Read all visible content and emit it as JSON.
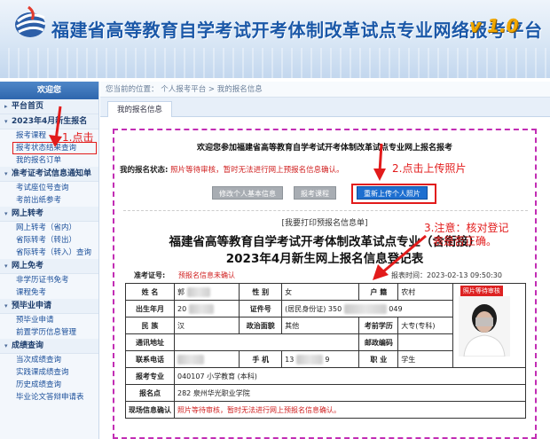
{
  "header": {
    "title": "福建省高等教育自学考试开考体制改革试点专业网络报考平台",
    "version": "v 1.0"
  },
  "sidebar": {
    "welcome": "欢迎您",
    "sections": [
      {
        "label": "平台首页",
        "items": []
      },
      {
        "label": "2023年4月新生报名",
        "items": [
          "报考课程",
          "报考状态结果查询",
          "我的报名订单"
        ]
      },
      {
        "label": "准考证考试信息通知单",
        "items": [
          "考试座位号查询",
          "考前出纸参考"
        ]
      },
      {
        "label": "网上转考",
        "items": [
          "网上转考（省内）",
          "省际转考（转出）",
          "省际转考（转入）查询"
        ]
      },
      {
        "label": "网上免考",
        "items": [
          "非学历证书免考",
          "课程免考"
        ]
      },
      {
        "label": "预毕业申请",
        "items": [
          "预毕业申请",
          "前置学历信息管理"
        ]
      },
      {
        "label": "成绩查询",
        "items": [
          "当次成绩查询",
          "实践课成绩查询",
          "历史成绩查询",
          "毕业论文答辩申请表"
        ]
      }
    ]
  },
  "breadcrumb": "您当前的位置：  个人报考平台 > 我的报名信息",
  "tab": "我的报名信息",
  "content": {
    "intro": "欢迎您参加福建省高等教育自学考试开考体制改革试点专业网上报名报考",
    "status_label": "我的报名状态:",
    "status_value": "照片等待审核，暂时无法进行网上预报名信息确认。",
    "buttons": {
      "modify": "修改个人基本信息",
      "course": "报考课程",
      "reupload": "重新上传个人照片"
    },
    "print": "[我要打印预报名信息单]",
    "title_line1": "福建省高等教育自学考试开考体制改革试点专业（含衔接）",
    "title_line2": "2023年4月新生网上报名信息登记表",
    "ticket_label": "准考证号:",
    "ticket_value": "预报名信息未确认",
    "report_time": "报表时间：2023-02-13 09:50:30"
  },
  "table": {
    "name_k": "姓 名",
    "name_v": "郭",
    "gender_k": "性 别",
    "gender_v": "女",
    "hukou_k": "户 籍",
    "hukou_v": "农村",
    "photo_tag": "照片等待审核",
    "birth_k": "出生年月",
    "birth_v": "20",
    "id_k": "证件号",
    "id_v": "(居民身份证) 350",
    "id_tail": "049",
    "nation_k": "民 族",
    "nation_v": "汉",
    "politics_k": "政治面貌",
    "politics_v": "其他",
    "edu_k": "考前学历",
    "edu_v": "大专(专科)",
    "addr_k": "通讯地址",
    "addr_v": "",
    "zip_k": "邮政编码",
    "zip_v": "",
    "phone_k": "联系电话",
    "phone_v": "",
    "mobile_k": "手 机",
    "mobile_v": "13",
    "mobile_tail": "9",
    "job_k": "职 业",
    "job_v": "学生",
    "major_k": "报考专业",
    "major_v": "040107 小学教育 (本科)",
    "site_k": "报名点",
    "site_v": "282 泉州华光职业学院",
    "confirm_k": "现场信息确认",
    "confirm_v": "照片等待审核，暂时无法进行网上预报名信息确认。"
  },
  "annotations": {
    "a1": "1.点击",
    "a2": "2.点击上传照片",
    "a3_line1": "3.注意：核对登记",
    "a3_line2": "表是否正确。"
  },
  "colors": {
    "accent": "#1b58a8",
    "annotation": "#e21b1b",
    "status": "#d02020",
    "frame": "#c22db4"
  }
}
